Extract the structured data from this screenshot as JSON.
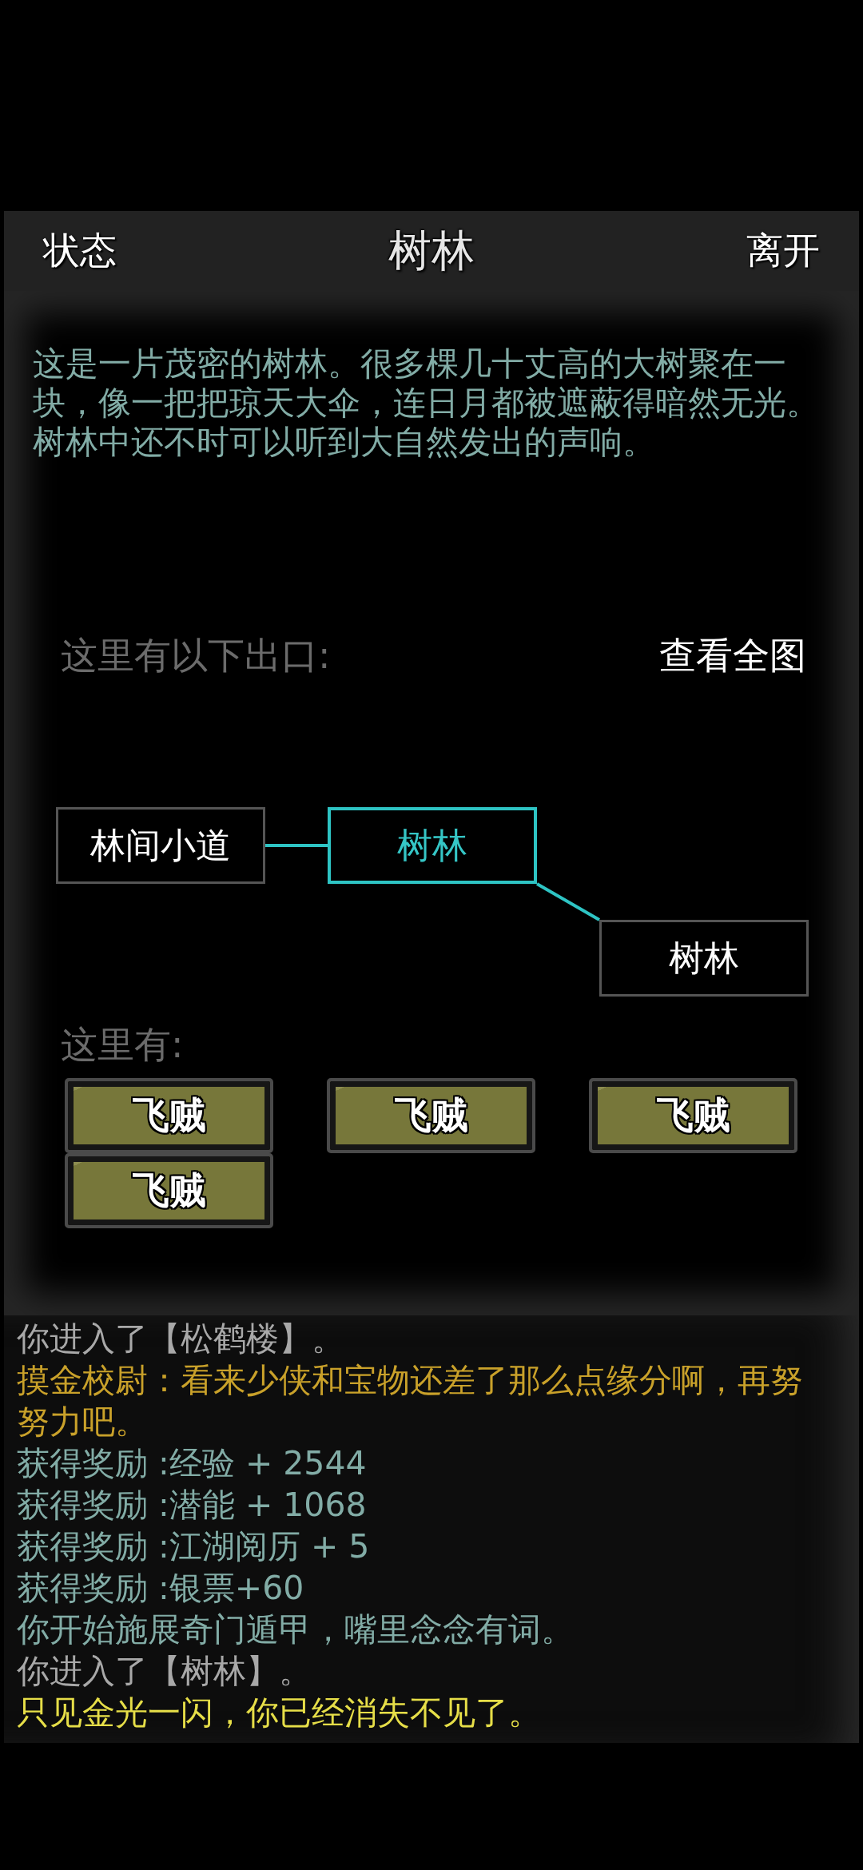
{
  "header": {
    "left_button": "状态",
    "title": "树林",
    "right_button": "离开"
  },
  "description": "这是一片茂密的树林。很多棵几十丈高的大树聚在一块，像一把把琼天大伞，连日月都被遮蔽得暗然无光。树林中还不时可以听到大自然发出的声响。",
  "exits": {
    "title": "这里有以下出口:",
    "map_button": "查看全图",
    "current_room": "树林",
    "rooms": [
      {
        "label": "林间小道",
        "kind": "west"
      },
      {
        "label": "树林",
        "kind": "southeast"
      }
    ]
  },
  "npcs": {
    "title": "这里有:",
    "items": [
      "飞贼",
      "飞贼",
      "飞贼",
      "飞贼"
    ]
  },
  "log": [
    {
      "text": "你进入了【松鹤楼】。",
      "color": "#a8a8a8"
    },
    {
      "text": "摸金校尉：看来少侠和宝物还差了那么点缘分啊，再努努力吧。",
      "color": "#c9a12a"
    },
    {
      "text": "获得奖励 :经验 + 2544",
      "color": "#82aca6"
    },
    {
      "text": "获得奖励 :潜能 + 1068",
      "color": "#82aca6"
    },
    {
      "text": "获得奖励 :江湖阅历 + 5",
      "color": "#82aca6"
    },
    {
      "text": "获得奖励 :银票+60",
      "color": "#82aca6"
    },
    {
      "text": "你开始施展奇门遁甲，嘴里念念有词。",
      "color": "#82aca6"
    },
    {
      "text": "你进入了【树林】。",
      "color": "#a8a8a8"
    },
    {
      "text": "只见金光一闪，你已经消失不见了。",
      "color": "#e6de48"
    }
  ]
}
